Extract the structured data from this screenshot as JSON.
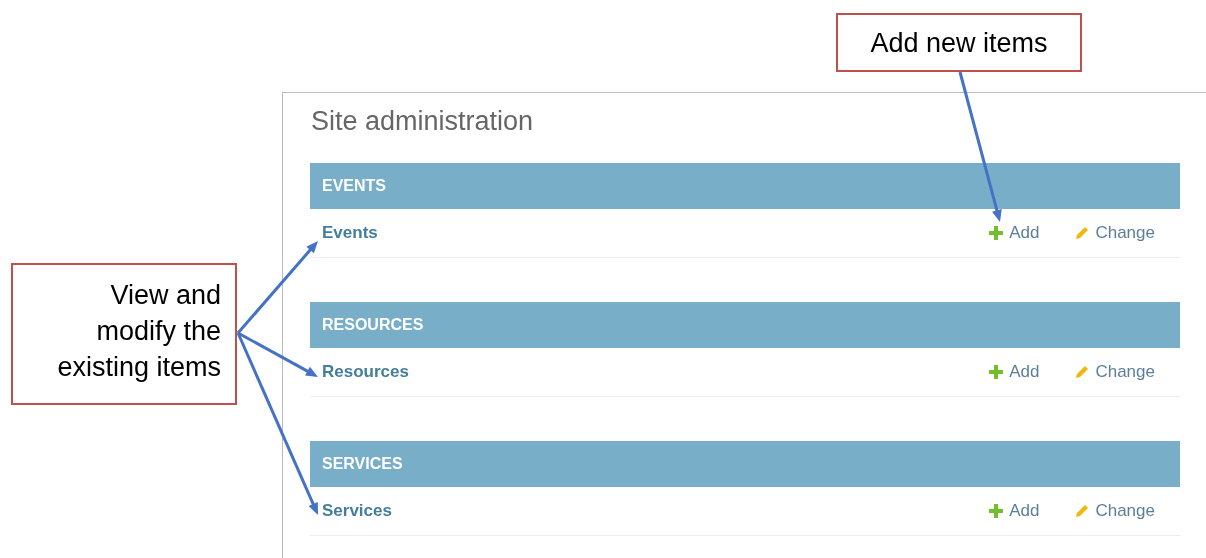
{
  "callouts": [
    {
      "kind": "top",
      "lines": [
        "Add new items"
      ]
    },
    {
      "kind": "left",
      "lines": [
        "View and",
        "modify the",
        "existing items"
      ]
    }
  ],
  "page": {
    "title": "Site administration"
  },
  "modules": [
    {
      "caption": "EVENTS",
      "models": [
        {
          "name": "Events",
          "add": "Add",
          "change": "Change"
        }
      ]
    },
    {
      "caption": "RESOURCES",
      "models": [
        {
          "name": "Resources",
          "add": "Add",
          "change": "Change"
        }
      ]
    },
    {
      "caption": "SERVICES",
      "models": [
        {
          "name": "Services",
          "add": "Add",
          "change": "Change"
        }
      ]
    }
  ]
}
